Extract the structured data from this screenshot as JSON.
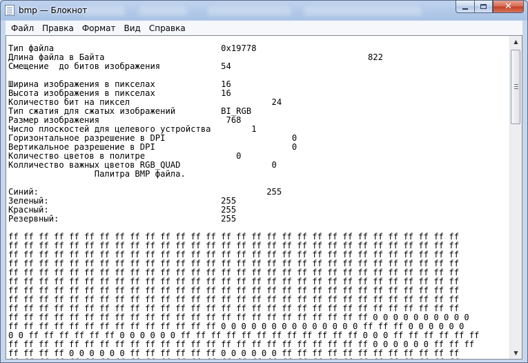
{
  "window": {
    "title": "bmp — Блокнот",
    "minimize_label": "",
    "maximize_label": "",
    "close_label": "✕"
  },
  "menu": [
    {
      "label": "Файл"
    },
    {
      "label": "Правка"
    },
    {
      "label": "Формат"
    },
    {
      "label": "Вид"
    },
    {
      "label": "Справка"
    }
  ],
  "document": {
    "lines": [
      "Тип файла                                 0x19778",
      "Длина файла в Байта                                                    822",
      "Смещение  до битов изображения            54",
      "",
      "Ширина изображения в пикселах             16",
      "Высота изображения в пикселах             16",
      "Количество бит на пиксел                            24",
      "Тип сжатия для сжатых изображений         BI_RGB",
      "Размер изображения                         768",
      "Число плоскостей для целевого устройства        1",
      "Горизонтальное разрешение в DPI                         0",
      "Вертикальное разрешение в DPI                           0",
      "Количество цветов в политре                  0",
      "Колличество важных цветов RGB_QUAD                  0",
      "                 Палитра BMP файла.",
      "",
      "Синий:                                             255",
      "Зеленый:                                  255",
      "Красный:                                  255",
      "Резервный:                                255",
      "",
      "ff ff ff ff ff ff ff ff ff ff ff ff ff ff ff ff ff ff ff ff ff ff ff ff ff ff ff ff ff ff",
      "ff ff ff ff ff ff ff ff ff ff ff ff ff ff ff ff ff ff ff ff ff ff ff ff ff ff ff ff ff ff",
      "ff ff ff ff ff ff ff ff ff ff ff ff ff ff ff ff ff ff ff ff ff ff ff ff ff ff ff ff ff ff",
      "ff ff ff ff ff ff ff ff ff ff ff ff ff ff ff ff ff ff ff ff ff ff ff ff ff ff ff ff ff ff",
      "ff ff ff ff ff ff ff ff ff ff ff ff ff ff ff ff ff ff ff ff ff ff ff ff ff ff ff ff ff ff",
      "ff ff ff ff ff ff ff ff ff ff ff ff ff ff ff ff ff ff ff ff ff ff ff ff ff ff ff ff ff ff",
      "ff ff ff ff ff ff ff ff ff ff ff ff ff ff ff ff ff ff ff ff ff ff ff ff ff ff ff ff ff ff",
      "ff ff ff ff ff ff ff ff ff ff ff ff ff ff ff ff ff ff ff ff ff ff ff ff ff ff ff ff ff ff",
      "ff ff ff ff ff ff ff ff ff ff ff ff ff ff ff ff ff ff ff ff ff ff ff ff ff ff ff ff ff ff",
      "ff ff ff ff ff ff ff ff ff ff ff ff ff ff ff ff ff ff ff ff ff ff ff ff 0 0 0 0 0 0 0 0 0 0",
      "ff ff ff ff ff ff ff ff ff ff ff ff ff ff 0 0 0 0 0 0 0 0 0 0 0 0 0 0 ff ff ff 0 0 0 0 0 0",
      "0 0 ff ff ff ff ff ff 0 0 0 0 0 0 ff ff ff ff ff ff ff ff ff ff ff ff 0 0 0 ff ff ff ff ff ff",
      "ff ff ff ff ff ff ff ff ff ff ff ff ff ff ff ff ff ff ff ff ff ff ff ff 0 0 0 0 0 0 ff ff ff",
      "ff ff ff ff 0 0 0 0 0 0 ff ff ff ff ff ff 0 0 0 0 0 0 ff ff ff ff ff ff ff ff ff ff ff ff",
      "ff ff ff ff ff ff ff ff ff ff ff ff ff ff ff ff ff ff ff ff ff ff ff ff ff ff ff ff ff ff"
    ]
  },
  "scrollbar": {
    "up_icon": "▲",
    "down_icon": "▼"
  }
}
